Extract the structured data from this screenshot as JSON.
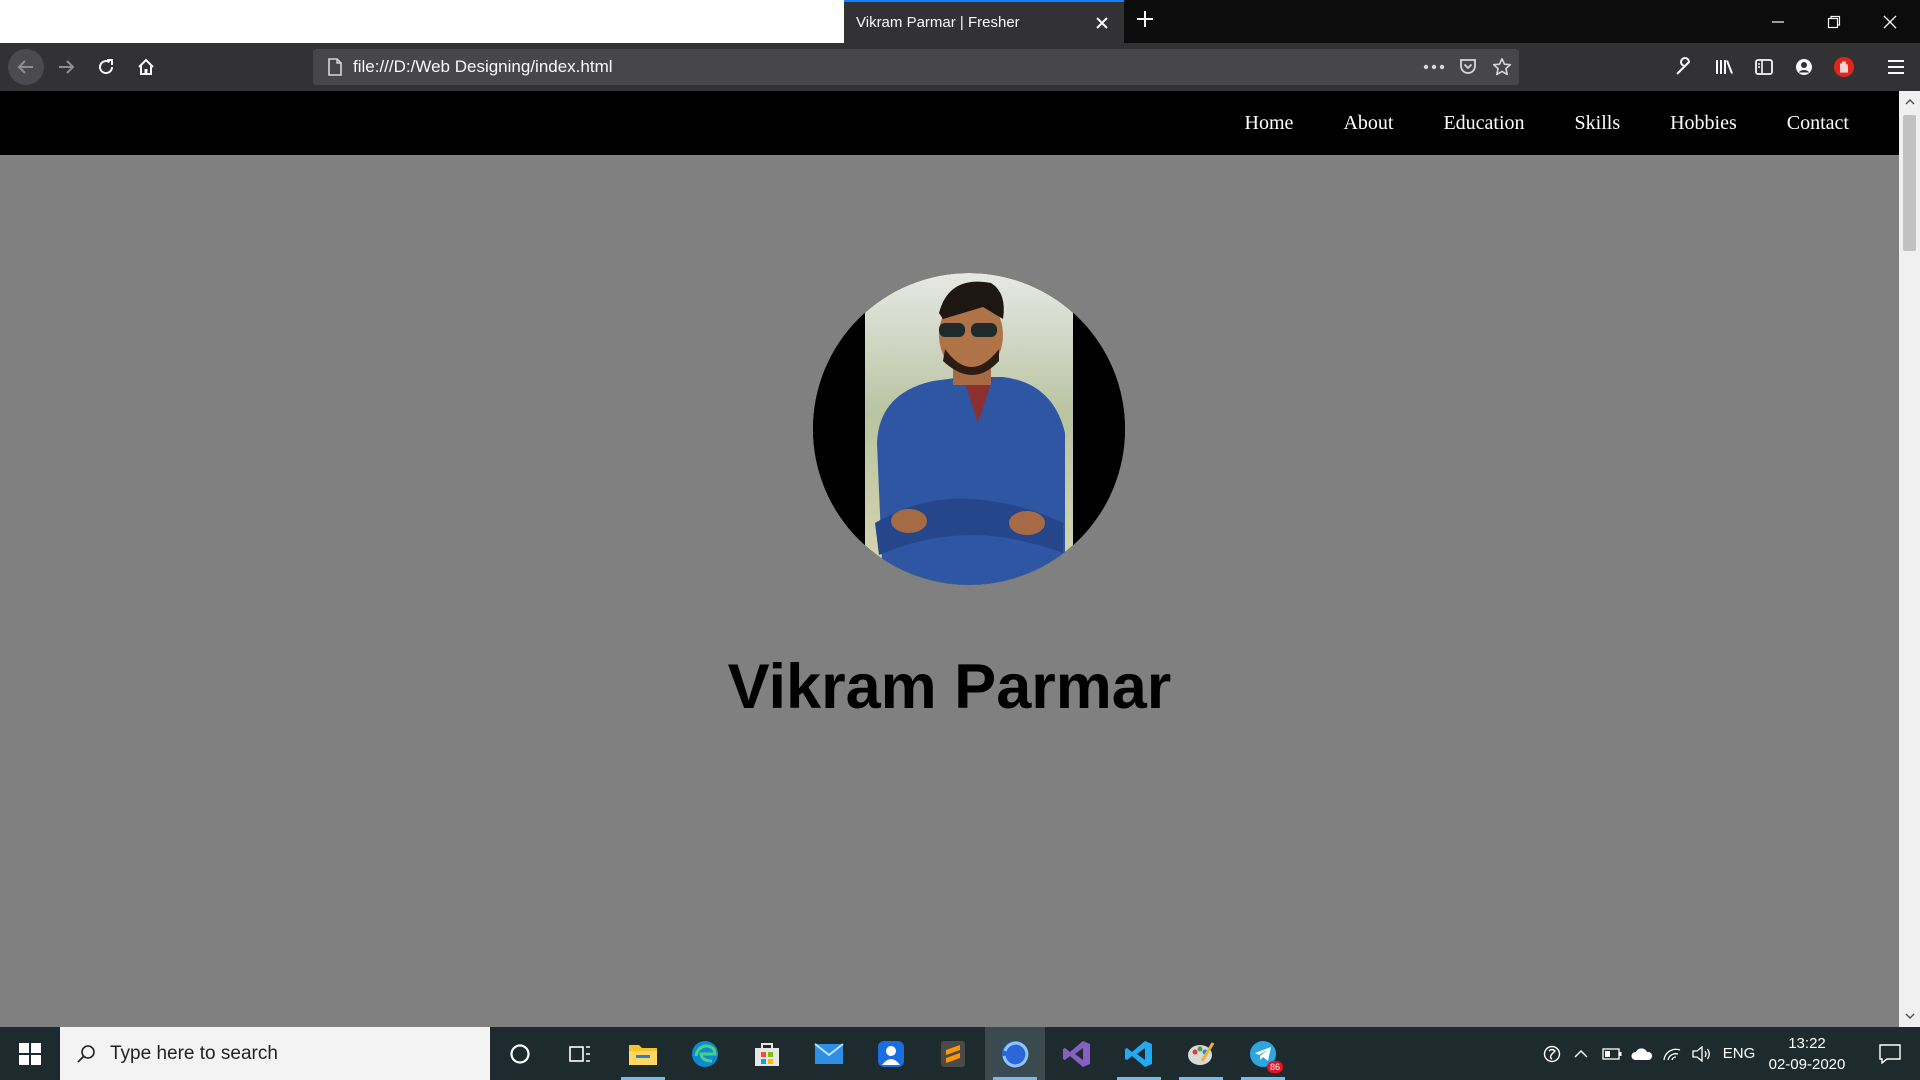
{
  "browser": {
    "tab_title": "Vikram Parmar | Fresher",
    "url": "file:///D:/Web Designing/index.html"
  },
  "site": {
    "nav": [
      "Home",
      "About",
      "Education",
      "Skills",
      "Hobbies",
      "Contact"
    ],
    "name": "Vikram Parmar"
  },
  "taskbar": {
    "search_placeholder": "Type here to search",
    "language": "ENG",
    "time": "13:22",
    "date": "02-09-2020",
    "telegram_badge": "86"
  },
  "colors": {
    "page_background": "#808080",
    "site_nav_background": "#000000",
    "tab_accent": "#0a84ff",
    "taskbar_background": "#1d2b2e"
  },
  "icons": {
    "browser": [
      "back-icon",
      "forward-icon",
      "reload-icon",
      "home-icon",
      "page-icon",
      "more-actions-icon",
      "pocket-icon",
      "bookmark-star-icon",
      "wrench-icon",
      "library-icon",
      "sidebar-icon",
      "account-icon",
      "extension-icon",
      "hamburger-menu-icon"
    ],
    "taskbar": [
      "windows-start-icon",
      "search-icon",
      "cortana-icon",
      "task-view-icon",
      "file-explorer-icon",
      "edge-icon",
      "store-icon",
      "mail-icon",
      "app-icon",
      "sublime-text-icon",
      "firefox-icon",
      "visual-studio-icon",
      "vscode-icon",
      "paint-icon",
      "telegram-icon"
    ]
  }
}
